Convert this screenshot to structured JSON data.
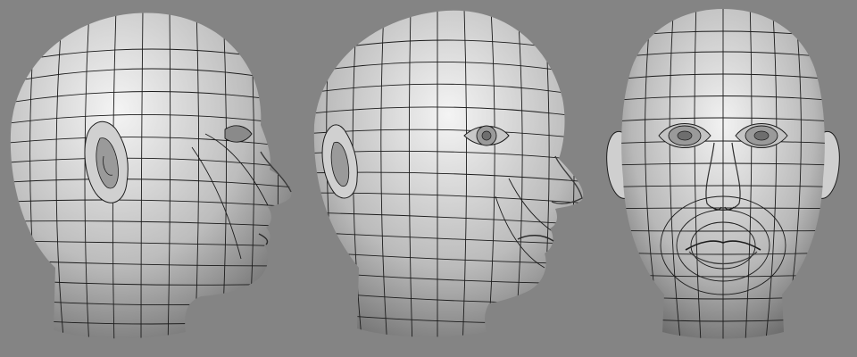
{
  "scene": {
    "background_color": "#848484",
    "skin_light": "#f2f2f2",
    "skin_mid": "#b4b4b4",
    "skin_dark": "#555555",
    "wire_color": "#1c1c1c",
    "views": [
      {
        "name": "side-profile-view",
        "orientation": "left-profile"
      },
      {
        "name": "three-quarter-view",
        "orientation": "three-quarter-right"
      },
      {
        "name": "front-view",
        "orientation": "front"
      }
    ]
  }
}
